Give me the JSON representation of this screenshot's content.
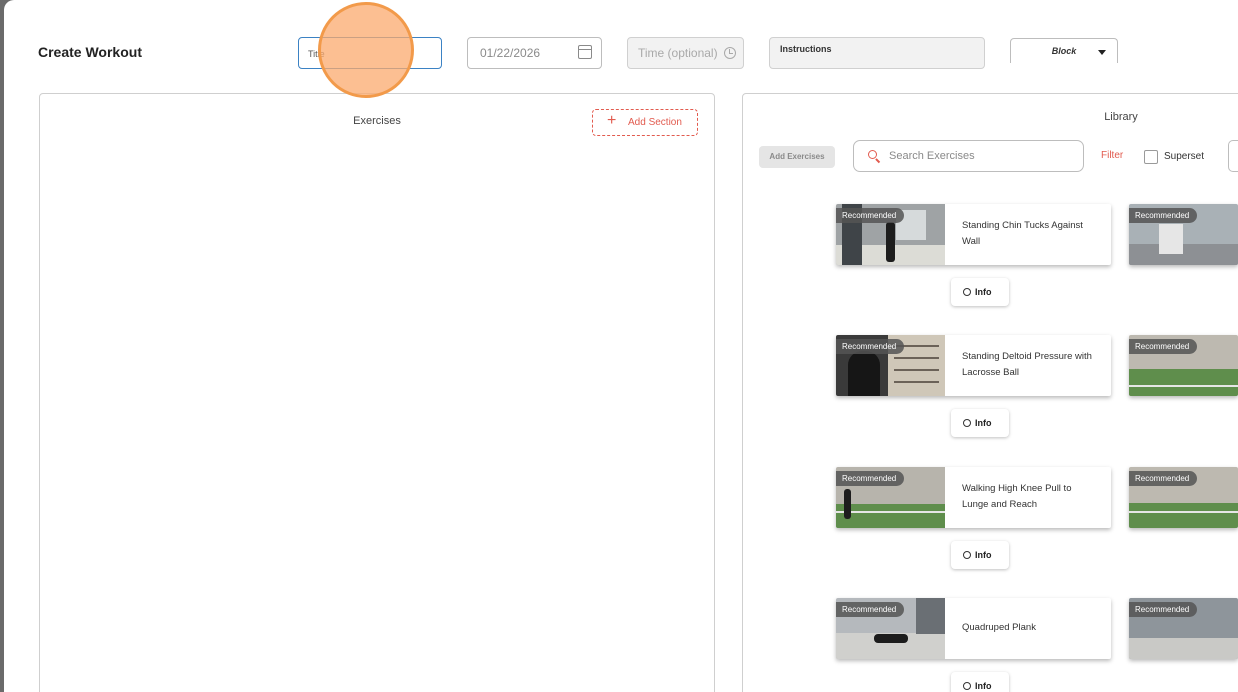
{
  "header": {
    "title": "Create Workout",
    "title_field_value": "Title",
    "date_value": "01/22/2026",
    "time_placeholder": "Time (optional)",
    "instructions_label": "Instructions",
    "block_select_value": "Block"
  },
  "exercises_panel": {
    "title": "Exercises",
    "add_section_label": "Add Section"
  },
  "library": {
    "title": "Library",
    "add_exercises_label": "Add Exercises",
    "search_placeholder": "Search Exercises",
    "filter_label": "Filter",
    "superset_label": "Superset",
    "superset_checked": false,
    "badge_label": "Recommended",
    "info_label": "Info",
    "cards": [
      {
        "name": "Standing Chin Tucks Against Wall",
        "thumb_scene": "hallway",
        "badge": "Recommended",
        "info": "Info"
      },
      {
        "name": "Standing Deltoid Pressure with Lacrosse Ball",
        "thumb_scene": "how-to-poster",
        "badge": "Recommended",
        "info": "Info"
      },
      {
        "name": "Walking High Knee Pull to Lunge and Reach",
        "thumb_scene": "turf-field",
        "badge": "Recommended",
        "info": "Info"
      },
      {
        "name": "Quadruped Plank",
        "thumb_scene": "gym-floor",
        "badge": "Recommended",
        "info": "Info"
      }
    ],
    "second_column_badges": [
      "Recommended",
      "Recommended",
      "Recommended",
      "Recommended"
    ]
  },
  "colors": {
    "accent_red": "#e25b4f",
    "focus_blue": "#3b82c4",
    "cursor_orange": "#f29a4a",
    "backdrop": "#6b6b6b"
  }
}
